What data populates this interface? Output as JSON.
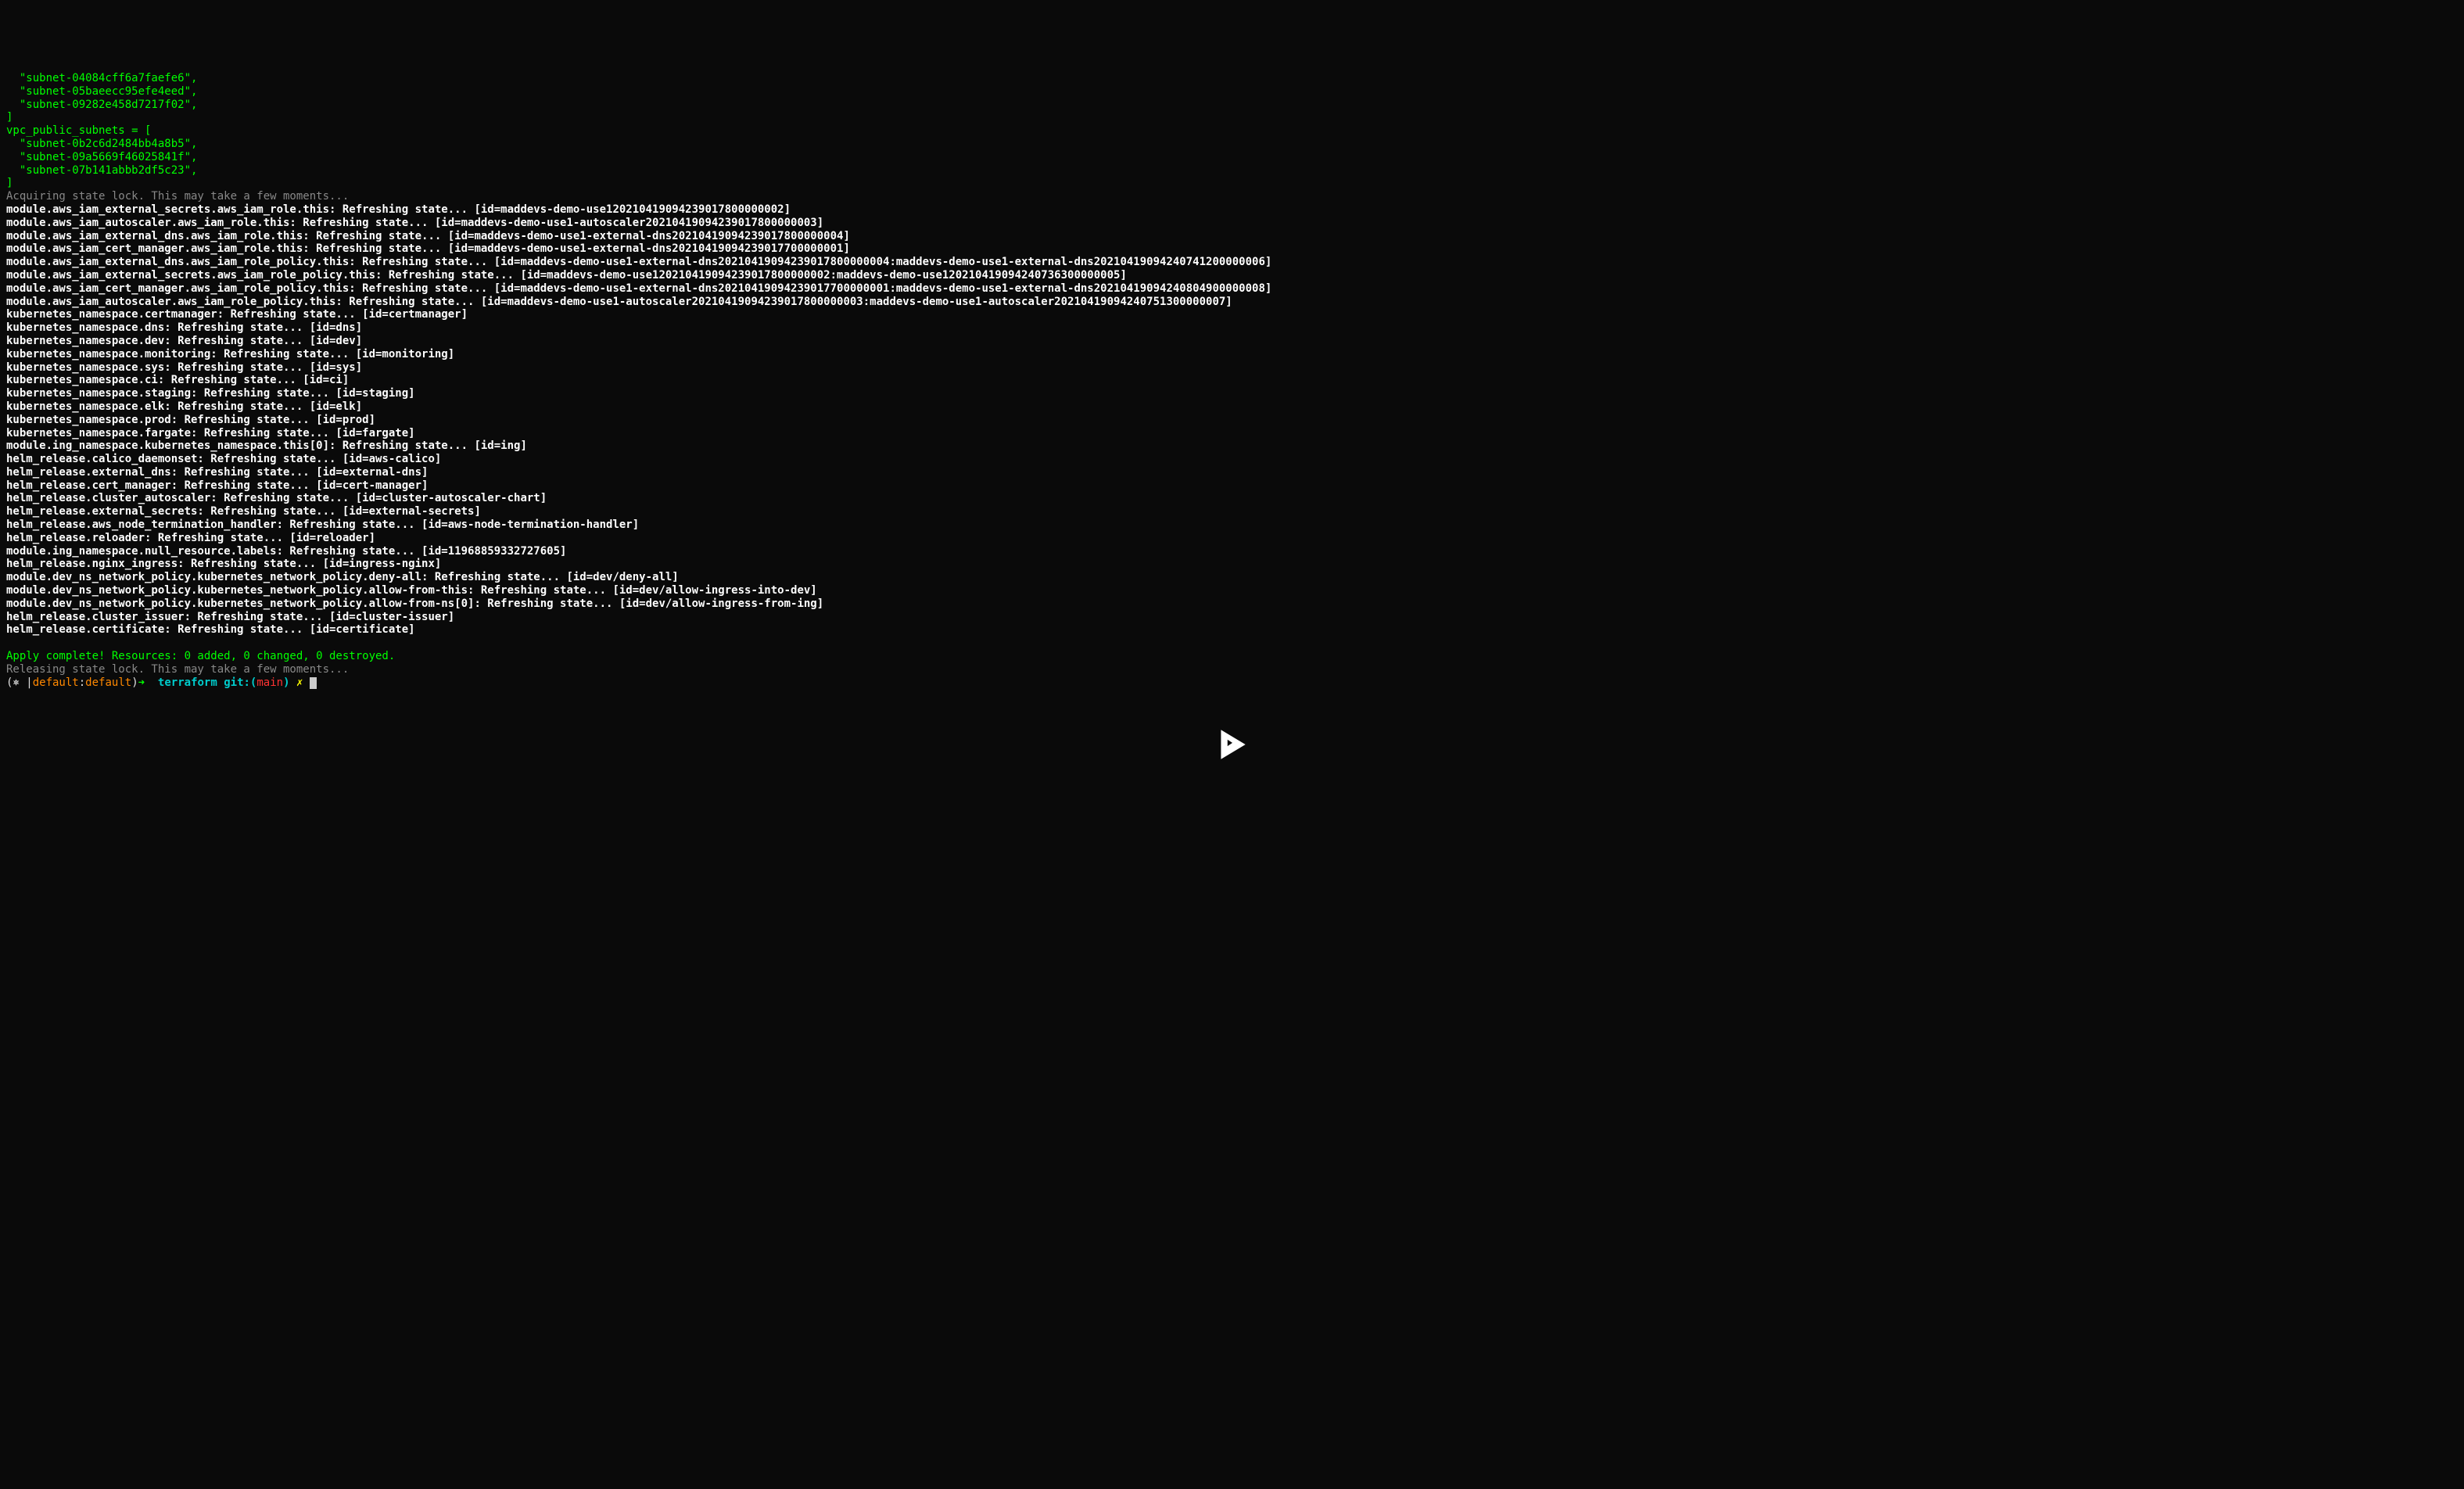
{
  "subnets_block": {
    "line1": "  \"subnet-04084cff6a7faefe6\",",
    "line2": "  \"subnet-05baeecc95efe4eed\",",
    "line3": "  \"subnet-09282e458d7217f02\",",
    "line4": "]",
    "line5": "vpc_public_subnets = [",
    "line6": "  \"subnet-0b2c6d2484bb4a8b5\",",
    "line7": "  \"subnet-09a5669f46025841f\",",
    "line8": "  \"subnet-07b141abbb2df5c23\",",
    "line9": "]"
  },
  "acquiring": "Acquiring state lock. This may take a few moments...",
  "refresh_lines": [
    "module.aws_iam_external_secrets.aws_iam_role.this: Refreshing state... [id=maddevs-demo-use120210419094239017800000002]",
    "module.aws_iam_autoscaler.aws_iam_role.this: Refreshing state... [id=maddevs-demo-use1-autoscaler20210419094239017800000003]",
    "module.aws_iam_external_dns.aws_iam_role.this: Refreshing state... [id=maddevs-demo-use1-external-dns20210419094239017800000004]",
    "module.aws_iam_cert_manager.aws_iam_role.this: Refreshing state... [id=maddevs-demo-use1-external-dns20210419094239017700000001]",
    "module.aws_iam_external_dns.aws_iam_role_policy.this: Refreshing state... [id=maddevs-demo-use1-external-dns20210419094239017800000004:maddevs-demo-use1-external-dns20210419094240741200000006]",
    "module.aws_iam_external_secrets.aws_iam_role_policy.this: Refreshing state... [id=maddevs-demo-use120210419094239017800000002:maddevs-demo-use120210419094240736300000005]",
    "module.aws_iam_cert_manager.aws_iam_role_policy.this: Refreshing state... [id=maddevs-demo-use1-external-dns20210419094239017700000001:maddevs-demo-use1-external-dns20210419094240804900000008]",
    "module.aws_iam_autoscaler.aws_iam_role_policy.this: Refreshing state... [id=maddevs-demo-use1-autoscaler20210419094239017800000003:maddevs-demo-use1-autoscaler20210419094240751300000007]",
    "kubernetes_namespace.certmanager: Refreshing state... [id=certmanager]",
    "kubernetes_namespace.dns: Refreshing state... [id=dns]",
    "kubernetes_namespace.dev: Refreshing state... [id=dev]",
    "kubernetes_namespace.monitoring: Refreshing state... [id=monitoring]",
    "kubernetes_namespace.sys: Refreshing state... [id=sys]",
    "kubernetes_namespace.ci: Refreshing state... [id=ci]",
    "kubernetes_namespace.staging: Refreshing state... [id=staging]",
    "kubernetes_namespace.elk: Refreshing state... [id=elk]",
    "kubernetes_namespace.prod: Refreshing state... [id=prod]",
    "kubernetes_namespace.fargate: Refreshing state... [id=fargate]",
    "module.ing_namespace.kubernetes_namespace.this[0]: Refreshing state... [id=ing]",
    "helm_release.calico_daemonset: Refreshing state... [id=aws-calico]",
    "helm_release.external_dns: Refreshing state... [id=external-dns]",
    "helm_release.cert_manager: Refreshing state... [id=cert-manager]",
    "helm_release.cluster_autoscaler: Refreshing state... [id=cluster-autoscaler-chart]",
    "helm_release.external_secrets: Refreshing state... [id=external-secrets]",
    "helm_release.aws_node_termination_handler: Refreshing state... [id=aws-node-termination-handler]",
    "helm_release.reloader: Refreshing state... [id=reloader]",
    "module.ing_namespace.null_resource.labels: Refreshing state... [id=11968859332727605]",
    "helm_release.nginx_ingress: Refreshing state... [id=ingress-nginx]",
    "module.dev_ns_network_policy.kubernetes_network_policy.deny-all: Refreshing state... [id=dev/deny-all]",
    "module.dev_ns_network_policy.kubernetes_network_policy.allow-from-this: Refreshing state... [id=dev/allow-ingress-into-dev]",
    "module.dev_ns_network_policy.kubernetes_network_policy.allow-from-ns[0]: Refreshing state... [id=dev/allow-ingress-from-ing]",
    "helm_release.cluster_issuer: Refreshing state... [id=cluster-issuer]",
    "helm_release.certificate: Refreshing state... [id=certificate]"
  ],
  "apply_complete": "Apply complete! Resources: 0 added, 0 changed, 0 destroyed.",
  "releasing": "Releasing state lock. This may take a few moments...",
  "prompt": {
    "open": "(⎈ |",
    "ctx1": "default",
    "colon": ":",
    "ctx2": "default",
    "close": ")",
    "arrow": "➜",
    "dir": "terraform",
    "git_prefix": "git:(",
    "branch": "main",
    "git_suffix": ")",
    "dirty": "✗"
  }
}
